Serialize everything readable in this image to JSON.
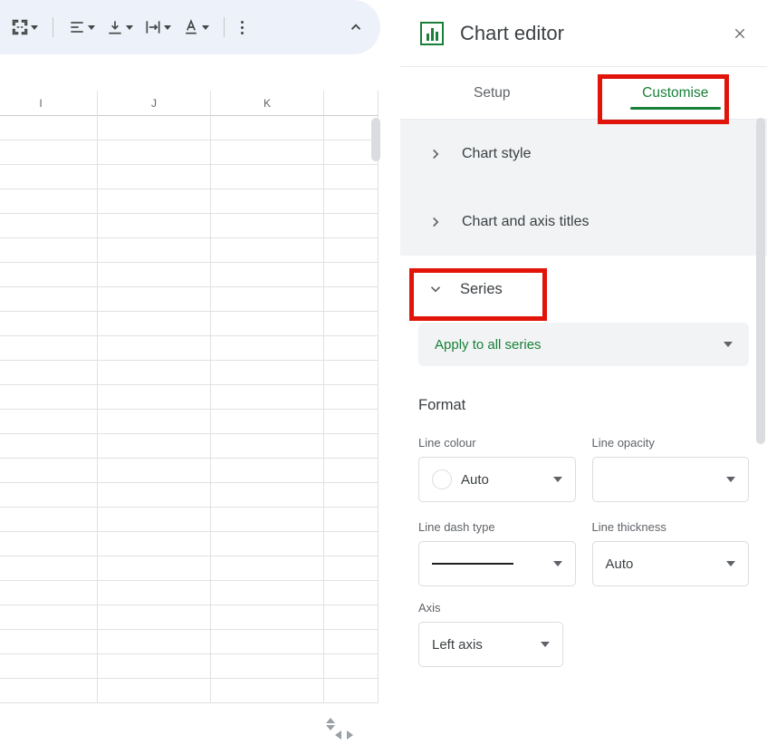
{
  "toolbar": {
    "collapse_icon": "chevron-up"
  },
  "grid": {
    "columns": [
      "I",
      "J",
      "K",
      ""
    ]
  },
  "sidebar": {
    "title": "Chart editor",
    "tabs": {
      "setup": "Setup",
      "customise": "Customise"
    },
    "sections": {
      "chart_style": "Chart style",
      "chart_axis_titles": "Chart and axis titles",
      "series": "Series"
    },
    "series_panel": {
      "apply_label": "Apply to all series",
      "format_header": "Format",
      "line_colour_label": "Line colour",
      "line_colour_value": "Auto",
      "line_opacity_label": "Line opacity",
      "line_opacity_value": "",
      "line_dash_label": "Line dash type",
      "line_thickness_label": "Line thickness",
      "line_thickness_value": "Auto",
      "axis_label": "Axis",
      "axis_value": "Left axis"
    }
  }
}
